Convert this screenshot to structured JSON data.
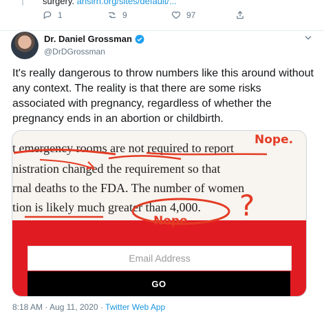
{
  "previous_tweet": {
    "text": "surgery.",
    "link": "ansirh.org/sites/default/...",
    "reply_count": "1",
    "retweet_count": "9",
    "like_count": "97"
  },
  "tweet": {
    "author_name": "Dr. Daniel Grossman",
    "author_handle": "@DrDGrossman",
    "text": "It's really dangerous to throw numbers like this around without any context. The reality is that there are some risks associated with pregnancy, regardless of whether the pregnancy ends in an abortion or childbirth.",
    "time": "8:18 AM",
    "date": "Aug 11, 2020",
    "source": "Twitter Web App"
  },
  "media": {
    "paper_lines": [
      "t emergency rooms are not required to report",
      "nistration changed the requirement so that",
      "rnal deaths to the FDA. The number of women",
      "tion is likely much greater than 4,000."
    ],
    "annotations": {
      "nope_1": "Nope.",
      "nope_2": "Nope.",
      "question": "?"
    },
    "email_placeholder": "Email Address",
    "go_label": "GO"
  },
  "colors": {
    "accent": "#1b95e0",
    "annotation_red": "#e33b24",
    "signup_red": "#e11b22"
  }
}
